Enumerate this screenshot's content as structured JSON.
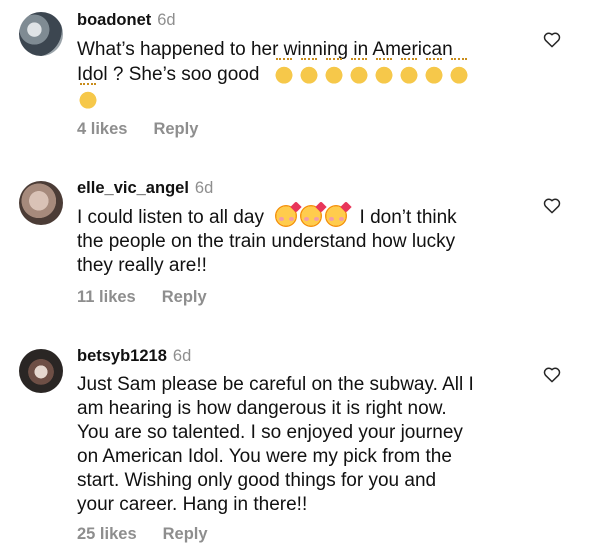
{
  "comments": [
    {
      "username": "boadonet",
      "time": "6d",
      "text_line1": "What’s happened to her winning in American",
      "text_line2": "Idol ? She’s soo good",
      "emoji_name": "clapping-hands",
      "likes": "4 likes",
      "reply": "Reply"
    },
    {
      "username": "elle_vic_angel",
      "time": "6d",
      "text_line1a": "I could listen to all day",
      "text_line1b": "I don’t think",
      "text_line2": "the people on the train understand how lucky",
      "text_line3": "they really are!!",
      "emoji_name": "smiling-face-with-hearts",
      "likes": "11 likes",
      "reply": "Reply"
    },
    {
      "username": "betsyb1218",
      "time": "6d",
      "lines": [
        "Just Sam please be careful on the subway.  All I",
        "am hearing is how dangerous it is right now.",
        "You are so talented.  I  so enjoyed your journey",
        "on American Idol.  You were my pick from the",
        "start.  Wishing only good things for you and",
        "your career.  Hang in there!!"
      ],
      "likes": "25 likes",
      "reply": "Reply"
    }
  ],
  "icons": {
    "like": "heart-outline-icon"
  },
  "colors": {
    "text": "#111111",
    "muted": "#8e8e8e",
    "background": "#ffffff"
  }
}
